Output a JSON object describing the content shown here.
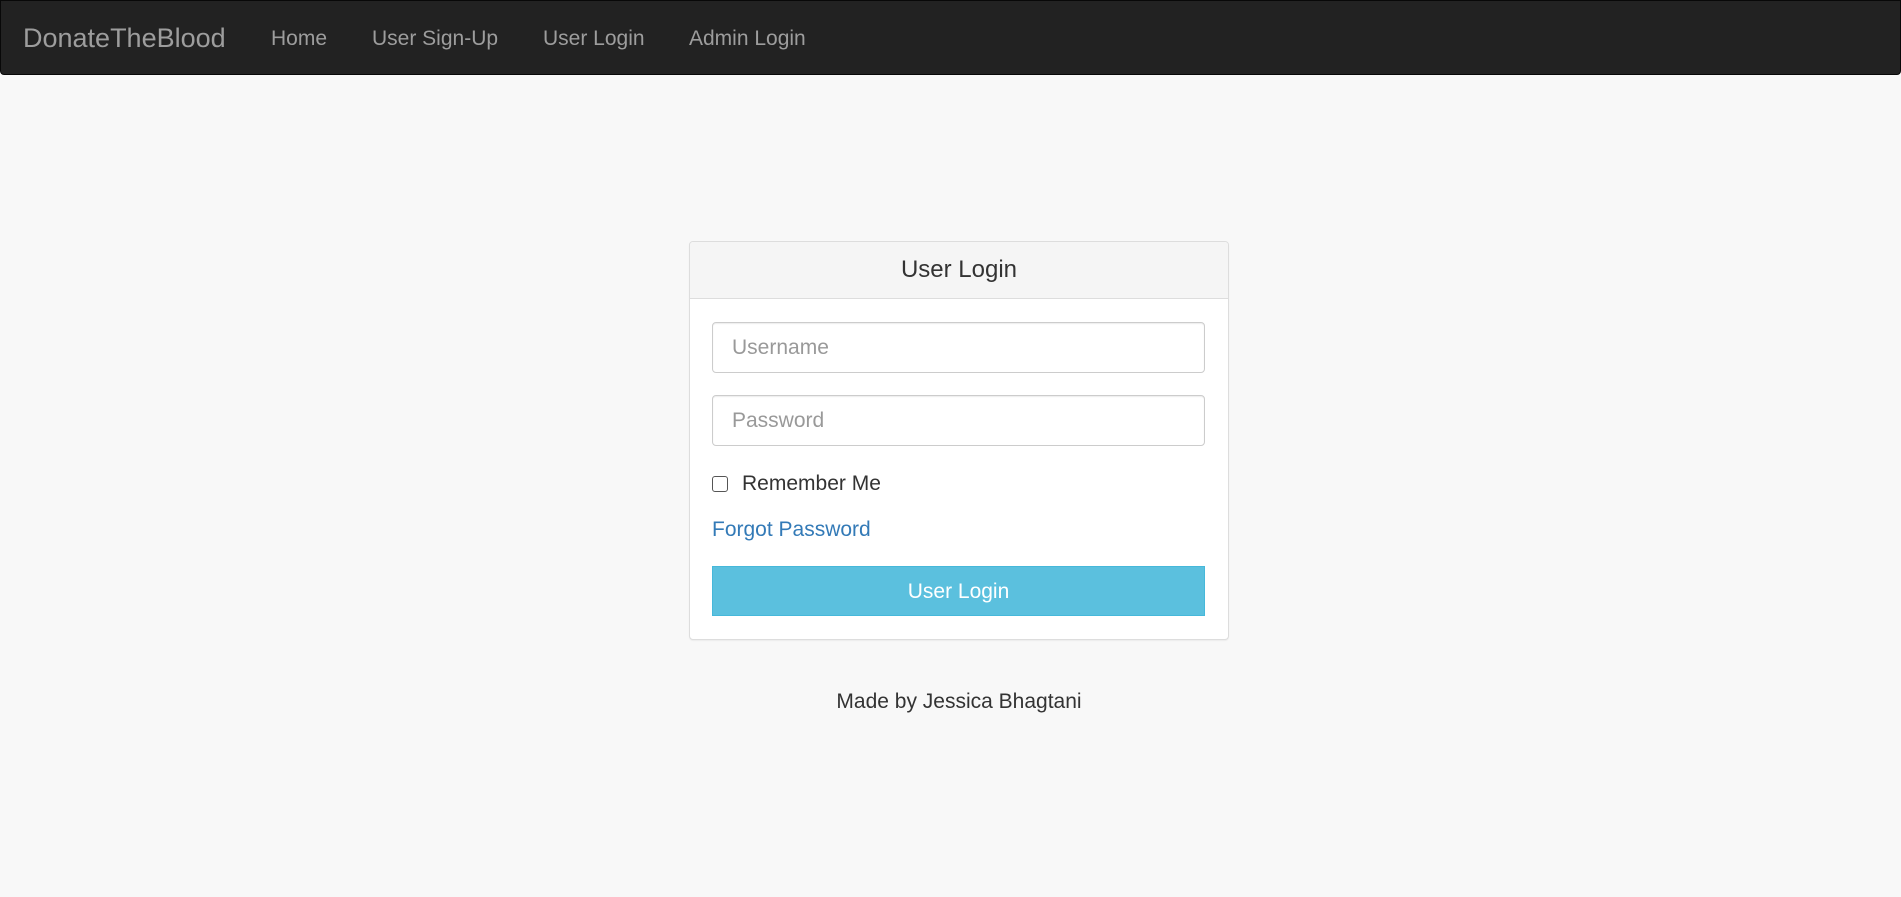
{
  "navbar": {
    "brand": "DonateTheBlood",
    "links": [
      "Home",
      "User Sign-Up",
      "User Login",
      "Admin Login"
    ]
  },
  "login_panel": {
    "title": "User Login",
    "username_placeholder": "Username",
    "password_placeholder": "Password",
    "remember_label": "Remember Me",
    "remember_checked": false,
    "forgot_password": "Forgot Password",
    "submit_label": "User Login"
  },
  "footer": {
    "text": "Made by Jessica Bhagtani"
  },
  "colors": {
    "navbar_bg": "#222222",
    "nav_text": "#9d9d9d",
    "page_bg": "#f8f8f8",
    "button_bg": "#5bc0de",
    "link": "#337ab7"
  }
}
